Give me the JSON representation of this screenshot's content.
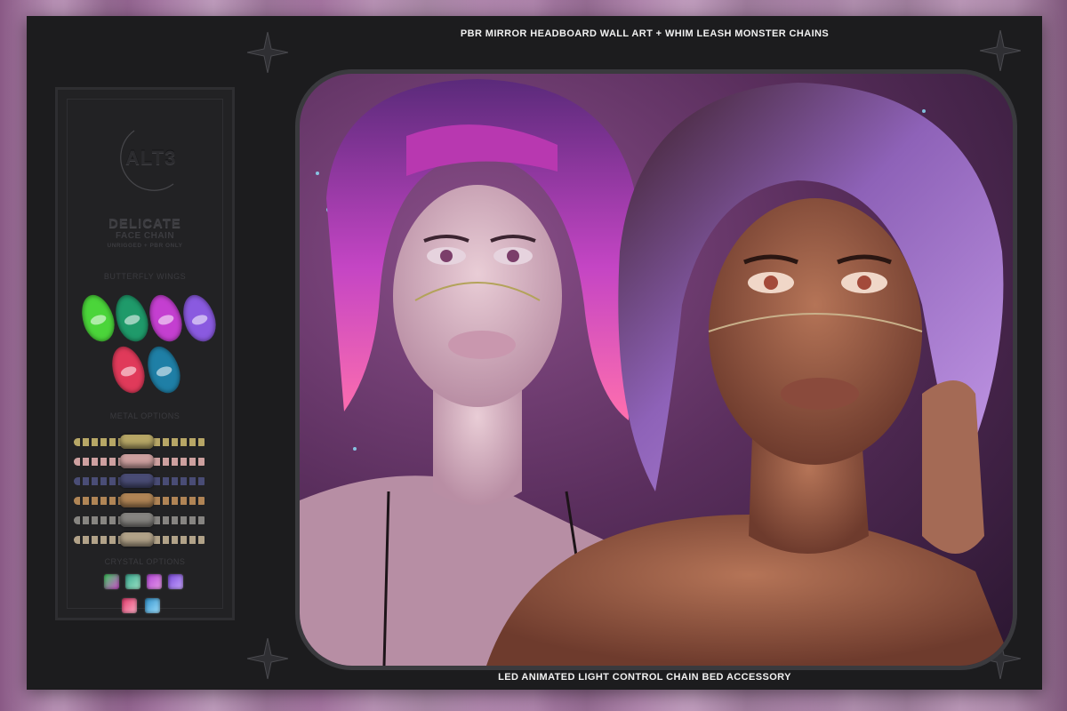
{
  "captions": {
    "top": "PBR MIRROR HEADBOARD WALL ART + WHIM LEASH MONSTER CHAINS",
    "bottom": "LED ANIMATED LIGHT CONTROL CHAIN BED ACCESSORY"
  },
  "brand": {
    "logo_text": "ALT3"
  },
  "product": {
    "name": "DELICATE",
    "type": "FACE CHAIN",
    "note": "UNRIGGED + PBR ONLY"
  },
  "sections": {
    "wings_label": "BUTTERFLY WINGS",
    "metal_label": "METAL OPTIONS",
    "crystal_label": "CRYSTAL OPTIONS"
  },
  "colors": {
    "wings": [
      "#4bd53a",
      "#1f9a6a",
      "#c43fd0",
      "#8a5ae0",
      "#e03a5a",
      "#1f7fa6"
    ],
    "metals": [
      "#bfae6a",
      "#d7a7a6",
      "#4c4f7a",
      "#b88a58",
      "#8c8a86",
      "#b9a98e"
    ],
    "crystals": [
      "#3fd060",
      "#3aa58e",
      "#b046d4",
      "#7a4ad8",
      "#e03a6a",
      "#2f8fc8"
    ]
  }
}
